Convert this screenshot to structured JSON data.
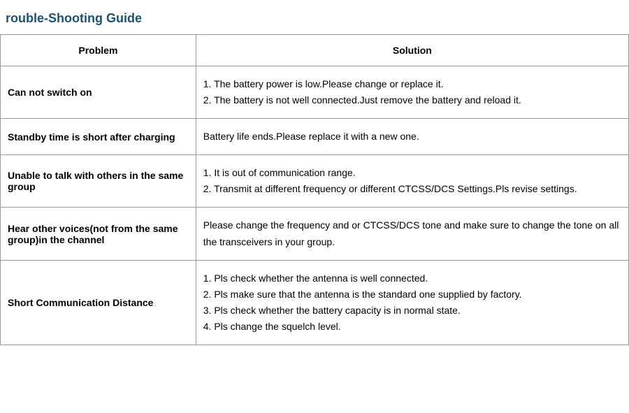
{
  "title": "rouble-Shooting Guide",
  "table": {
    "header": {
      "problem_col": "Problem",
      "solution_col": "Solution"
    },
    "rows": [
      {
        "problem": "Can not switch on",
        "solution": "1. The battery power is low.Please change or replace it.\n2. The battery is not well connected.Just remove the battery and reload it."
      },
      {
        "problem": "Standby time is short after charging",
        "solution": "Battery life ends.Please replace it with a new one."
      },
      {
        "problem": "Unable to talk with others in the same group",
        "solution": "1. It is out of communication range.\n2.  Transmit at different frequency or different CTCSS/DCS Settings.Pls revise settings."
      },
      {
        "problem": "Hear other voices(not from the same group)in the channel",
        "solution": "Please change the frequency and or CTCSS/DCS tone and make sure to change the tone on all the transceivers in your group."
      },
      {
        "problem": "Short Communication Distance",
        "solution": "1. Pls check whether the antenna is well connected.\n2. Pls make sure that the antenna is the standard one supplied by factory.\n3. Pls check whether the battery capacity is in normal state.\n4. Pls change the squelch level."
      }
    ]
  }
}
